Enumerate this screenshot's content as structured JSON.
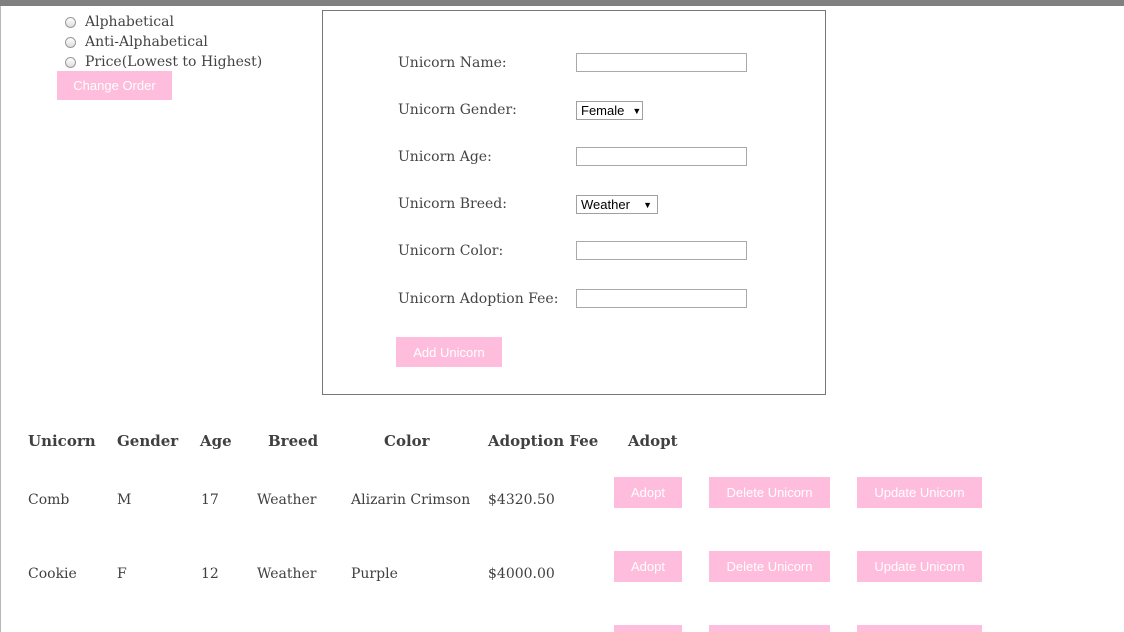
{
  "sort": {
    "options": [
      "Alphabetical",
      "Anti-Alphabetical",
      "Price(Lowest to Highest)"
    ],
    "button_label": "Change Order"
  },
  "form": {
    "name_label": "Unicorn Name:",
    "name_value": "",
    "gender_label": "Unicorn Gender:",
    "gender_value": "Female",
    "age_label": "Unicorn Age:",
    "age_value": "",
    "breed_label": "Unicorn Breed:",
    "breed_value": "Weather",
    "color_label": "Unicorn Color:",
    "color_value": "",
    "fee_label": "Unicorn Adoption Fee:",
    "fee_value": "",
    "add_button": "Add Unicorn"
  },
  "table": {
    "headers": [
      "Unicorn",
      "Gender",
      "Age",
      "Breed",
      "Color",
      "Adoption Fee",
      "Adopt"
    ],
    "rows": [
      {
        "name": "Comb",
        "gender": "M",
        "age": "17",
        "breed": "Weather",
        "color": "Alizarin Crimson",
        "fee": "$4320.50"
      },
      {
        "name": "Cookie",
        "gender": "F",
        "age": "12",
        "breed": "Weather",
        "color": "Purple",
        "fee": "$4000.00"
      }
    ],
    "adopt_button": "Adopt",
    "delete_button": "Delete Unicorn",
    "update_button": "Update Unicorn"
  },
  "colors": {
    "button_pink": "#ffbddd",
    "top_bar": "#808080"
  }
}
